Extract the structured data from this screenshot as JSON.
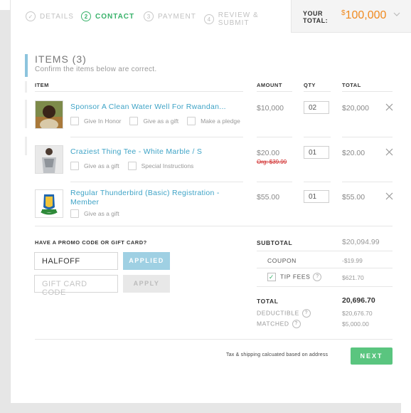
{
  "steps": [
    {
      "badge": "✓",
      "label": "DETAILS"
    },
    {
      "badge": "2",
      "label": "CONTACT"
    },
    {
      "badge": "3",
      "label": "PAYMENT"
    },
    {
      "badge": "4",
      "label": "REVIEW & SUBMIT"
    }
  ],
  "header": {
    "your_total_line1": "YOUR",
    "your_total_line2": "TOTAL:",
    "currency": "$",
    "amount": "100,000",
    "chevron_icon": "chevron-down-icon"
  },
  "items_section": {
    "title": "ITEMS (3)",
    "subtitle": "Confirm the items below are correct.",
    "columns": [
      "ITEM",
      "AMOUNT",
      "QTY",
      "TOTAL"
    ]
  },
  "items": [
    {
      "name": "Sponsor A Clean Water Well For Rwandan...",
      "options": [
        "Give In Honor",
        "Give as a gift",
        "Make a pledge"
      ],
      "amount": "$10,000",
      "qty": "02",
      "total": "$20,000"
    },
    {
      "name": "Craziest Thing Tee - White Marble / S",
      "options": [
        "Give as a gift",
        "Special Instructions"
      ],
      "amount": "$20.00",
      "original_price": "Org: $39.99",
      "qty": "01",
      "total": "$20.00"
    },
    {
      "name_line1": "Regular Thunderbird (Basic) Registration -",
      "name_line2": "Member",
      "options": [
        "Give as a gift"
      ],
      "amount": "$55.00",
      "qty": "01",
      "total": "$55.00"
    }
  ],
  "promo": {
    "label": "HAVE A PROMO CODE OR GIFT CARD?",
    "code_value": "HALFOFF",
    "code_button": "APPLIED",
    "gift_placeholder": "GIFT CARD CODE",
    "gift_button": "APPLY"
  },
  "summary": {
    "subtotal_label": "SUBTOTAL",
    "subtotal": "$20,094.99",
    "coupon_label": "COUPON",
    "coupon": "-$19.99",
    "tip_label": "TIP FEES",
    "tip": "$621.70",
    "total_label": "TOTAL",
    "total": "20,696.70",
    "deductible_label": "DEDUCTIBLE",
    "deductible": "$20,676.70",
    "matched_label": "MATCHED",
    "matched": "$5,000.00",
    "help_glyph": "?",
    "check_glyph": "✓"
  },
  "footer": {
    "note": "Tax & shipping calcuated based on address",
    "next_button": "NEXT"
  },
  "colors": {
    "accent_green": "#5ac57f",
    "link_blue": "#3ea3c6",
    "total_orange": "#f08a1f",
    "applied_blue": "#9fd0e3"
  }
}
